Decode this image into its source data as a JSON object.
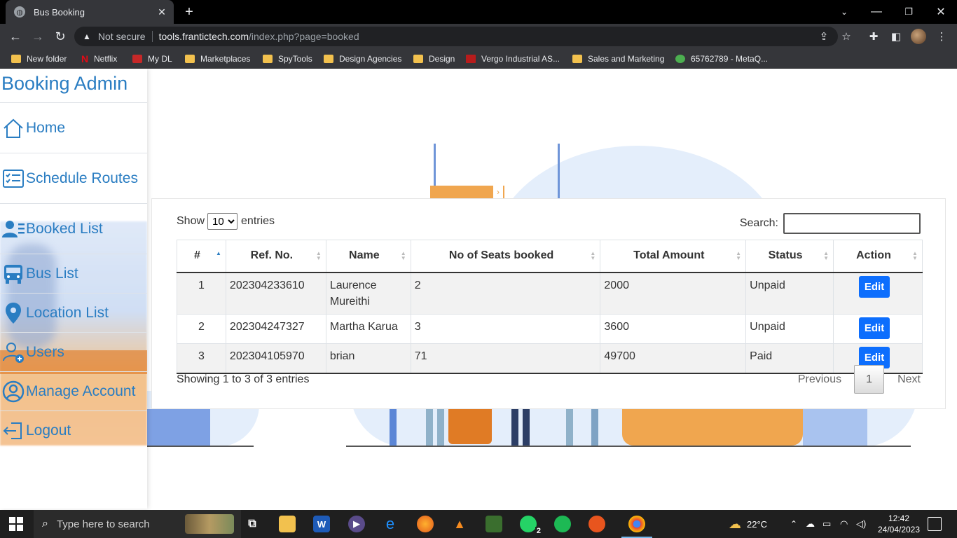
{
  "browser": {
    "tab_title": "Bus Booking",
    "omnibox": {
      "security": "Not secure",
      "host": "tools.frantictech.com",
      "path": "/index.php?page=booked"
    },
    "bookmarks": [
      {
        "label": "New folder",
        "icon": "folder-icon"
      },
      {
        "label": "Netflix",
        "icon": "netflix-icon"
      },
      {
        "label": "My DL",
        "icon": "mydl-icon"
      },
      {
        "label": "Marketplaces",
        "icon": "folder-icon"
      },
      {
        "label": "SpyTools",
        "icon": "folder-icon"
      },
      {
        "label": "Design Agencies",
        "icon": "folder-icon"
      },
      {
        "label": "Design",
        "icon": "folder-icon"
      },
      {
        "label": "Vergo Industrial AS...",
        "icon": "vergo-icon"
      },
      {
        "label": "Sales and Marketing",
        "icon": "folder-icon"
      },
      {
        "label": "65762789 - MetaQ...",
        "icon": "metaq-icon"
      }
    ]
  },
  "sidebar": {
    "brand": "Booking Admin",
    "items": [
      {
        "label": "Home",
        "icon": "home-icon"
      },
      {
        "label": "Schedule Routes",
        "icon": "checklist-icon"
      },
      {
        "label": "Booked List",
        "icon": "users-list-icon"
      },
      {
        "label": "Bus List",
        "icon": "bus-icon"
      },
      {
        "label": "Location List",
        "icon": "location-pin-icon"
      },
      {
        "label": "Users",
        "icon": "user-add-icon"
      },
      {
        "label": "Manage Account",
        "icon": "account-circle-icon"
      },
      {
        "label": "Logout",
        "icon": "logout-icon"
      }
    ]
  },
  "table": {
    "length": {
      "show": "Show",
      "value": "10",
      "entries": "entries"
    },
    "search_label": "Search:",
    "search_value": "",
    "columns": [
      "#",
      "Ref. No.",
      "Name",
      "No of Seats booked",
      "Total Amount",
      "Status",
      "Action"
    ],
    "rows": [
      {
        "idx": "1",
        "ref": "202304233610",
        "name": "Laurence Mureithi",
        "seats": "2",
        "amount": "2000",
        "status": "Unpaid",
        "action": "Edit"
      },
      {
        "idx": "2",
        "ref": "202304247327",
        "name": "Martha Karua",
        "seats": "3",
        "amount": "3600",
        "status": "Unpaid",
        "action": "Edit"
      },
      {
        "idx": "3",
        "ref": "202304105970",
        "name": "brian",
        "seats": "71",
        "amount": "49700",
        "status": "Paid",
        "action": "Edit"
      }
    ],
    "info": "Showing 1 to 3 of 3 entries",
    "pagination": {
      "previous": "Previous",
      "current": "1",
      "next": "Next"
    }
  },
  "taskbar": {
    "search_placeholder": "Type here to search",
    "whatsapp_badge": "2",
    "weather": "22°C",
    "time": "12:42",
    "date": "24/04/2023"
  },
  "colors": {
    "accent": "#2a7dc2",
    "button": "#0d6efd",
    "illustration_orange": "#f0a64f",
    "illustration_blue": "#6f95d8"
  }
}
